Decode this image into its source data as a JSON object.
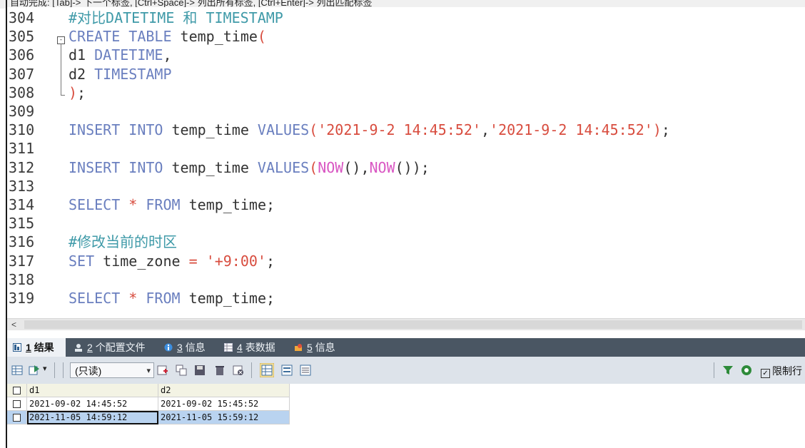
{
  "hint_bar": {
    "text": "自动完成: [Tab]-> 下一个标签, [Ctrl+Space]-> 列出所有标签, [Ctrl+Enter]-> 列出匹配标签"
  },
  "editor": {
    "lines": [
      {
        "num": "304",
        "tokens": [
          {
            "t": "#对比DATETIME 和 TIMESTAMP",
            "c": "c"
          }
        ]
      },
      {
        "num": "305",
        "tokens": [
          {
            "t": "CREATE TABLE ",
            "c": "k"
          },
          {
            "t": "temp_time",
            "c": "t"
          },
          {
            "t": "(",
            "c": "s"
          }
        ]
      },
      {
        "num": "306",
        "tokens": [
          {
            "t": "d1 ",
            "c": "t"
          },
          {
            "t": "DATETIME",
            "c": "k"
          },
          {
            "t": ",",
            "c": "t"
          }
        ]
      },
      {
        "num": "307",
        "tokens": [
          {
            "t": "d2 ",
            "c": "t"
          },
          {
            "t": "TIMESTAMP",
            "c": "k"
          }
        ]
      },
      {
        "num": "308",
        "tokens": [
          {
            "t": ")",
            "c": "s"
          },
          {
            "t": ";",
            "c": "t"
          }
        ]
      },
      {
        "num": "309",
        "tokens": []
      },
      {
        "num": "310",
        "tokens": [
          {
            "t": "INSERT INTO ",
            "c": "k"
          },
          {
            "t": "temp_time ",
            "c": "t"
          },
          {
            "t": "VALUES",
            "c": "k"
          },
          {
            "t": "(",
            "c": "s"
          },
          {
            "t": "'2021-9-2 14:45:52'",
            "c": "s"
          },
          {
            "t": ",",
            "c": "t"
          },
          {
            "t": "'2021-9-2 14:45:52'",
            "c": "s"
          },
          {
            "t": ")",
            "c": "s"
          },
          {
            "t": ";",
            "c": "t"
          }
        ]
      },
      {
        "num": "311",
        "tokens": []
      },
      {
        "num": "312",
        "tokens": [
          {
            "t": "INSERT INTO ",
            "c": "k"
          },
          {
            "t": "temp_time ",
            "c": "t"
          },
          {
            "t": "VALUES",
            "c": "k"
          },
          {
            "t": "(",
            "c": "s"
          },
          {
            "t": "NOW",
            "c": "f"
          },
          {
            "t": "()",
            "c": "t"
          },
          {
            "t": ",",
            "c": "t"
          },
          {
            "t": "NOW",
            "c": "f"
          },
          {
            "t": "())",
            "c": "t"
          },
          {
            "t": ";",
            "c": "t"
          }
        ]
      },
      {
        "num": "313",
        "tokens": []
      },
      {
        "num": "314",
        "tokens": [
          {
            "t": "SELECT ",
            "c": "k"
          },
          {
            "t": "* ",
            "c": "s"
          },
          {
            "t": "FROM ",
            "c": "k"
          },
          {
            "t": "temp_time",
            "c": "t"
          },
          {
            "t": ";",
            "c": "t"
          }
        ]
      },
      {
        "num": "315",
        "tokens": []
      },
      {
        "num": "316",
        "tokens": [
          {
            "t": "#修改当前的时区",
            "c": "c"
          }
        ]
      },
      {
        "num": "317",
        "tokens": [
          {
            "t": "SET ",
            "c": "k"
          },
          {
            "t": "time_zone ",
            "c": "t"
          },
          {
            "t": "= ",
            "c": "s"
          },
          {
            "t": "'+9:00'",
            "c": "s"
          },
          {
            "t": ";",
            "c": "t"
          }
        ]
      },
      {
        "num": "318",
        "tokens": []
      },
      {
        "num": "319",
        "tokens": [
          {
            "t": "SELECT ",
            "c": "k"
          },
          {
            "t": "* ",
            "c": "s"
          },
          {
            "t": "FROM ",
            "c": "k"
          },
          {
            "t": "temp_time",
            "c": "t"
          },
          {
            "t": ";",
            "c": "t"
          }
        ]
      }
    ],
    "fold_marker": "-"
  },
  "scrollbar": {
    "left_arrow": "<"
  },
  "tabs": [
    {
      "num": "1",
      "label": "结果",
      "icon": "result-grid-icon"
    },
    {
      "num": "2",
      "label": "个配置文件",
      "icon": "profile-icon"
    },
    {
      "num": "3",
      "label": "信息",
      "icon": "info-icon"
    },
    {
      "num": "4",
      "label": "表数据",
      "icon": "table-data-icon"
    },
    {
      "num": "5",
      "label": "信息",
      "icon": "info-icon"
    }
  ],
  "toolbar": {
    "readonly_select": "(只读)",
    "dropdown_arrow": "▾",
    "limit_label": "限制行",
    "limit_checked": "✓"
  },
  "grid": {
    "columns": [
      "d1",
      "d2"
    ],
    "rows": [
      [
        "2021-09-02 14:45:52",
        "2021-09-02 15:45:52"
      ],
      [
        "2021-11-05 14:59:12",
        "2021-11-05 15:59:12"
      ]
    ]
  },
  "colors": {
    "keyword": "#6a7fbf",
    "string": "#d84c3e",
    "function": "#d957c3",
    "comment": "#3f9aa8",
    "tab_bar": "#4a5663"
  }
}
